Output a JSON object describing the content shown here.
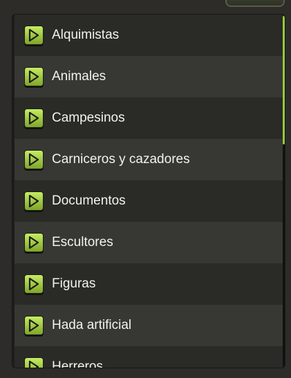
{
  "colors": {
    "accent": "#97c73c",
    "row_odd": "#2a2a27",
    "row_even": "#373834",
    "text": "#f2f2ee"
  },
  "list": {
    "icon": "play-icon",
    "items": [
      {
        "label": "Alquimistas"
      },
      {
        "label": "Animales"
      },
      {
        "label": "Campesinos"
      },
      {
        "label": "Carniceros y cazadores"
      },
      {
        "label": "Documentos"
      },
      {
        "label": "Escultores"
      },
      {
        "label": "Figuras"
      },
      {
        "label": "Hada artificial"
      },
      {
        "label": "Herreros"
      }
    ]
  }
}
